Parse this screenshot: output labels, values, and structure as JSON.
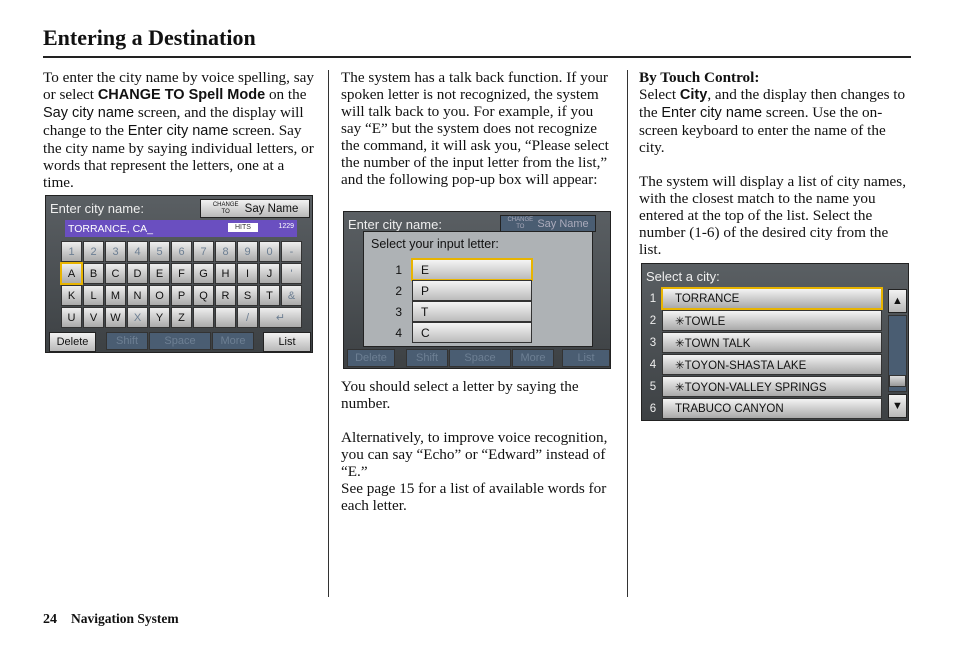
{
  "title": "Entering a Destination",
  "col1": {
    "t1": "To enter the city name by voice spelling, say or select ",
    "t2": "CHANGE TO Spell Mode",
    "t3": " on the ",
    "t4": "Say city name",
    "t5": " screen, and the display will change to the ",
    "t6": "Enter city name",
    "t7": " screen. Say the city name by saying individual letters, or words that represent the letters, one at a time."
  },
  "col2": {
    "p1": "The system has a talk back function. If your spoken letter is not recognized, the system will talk back to you. For example, if you say “E” but the system does not recognize the command, it will ask you, “Please select the number of the input letter from the list,” and the following pop-up box will appear:",
    "p2": "You should select a letter by saying the number.",
    "p3": "Alternatively, to improve voice recognition, you can say “Echo” or “Edward” instead of “E.”",
    "p4": "See page 15 for a list of available words for each letter."
  },
  "col3": {
    "heading": "By Touch Control:",
    "t1": "Select ",
    "t2": "City",
    "t3": ", and the display then changes to the ",
    "t4": "Enter city name",
    "t5": " screen. Use the on-screen keyboard to enter the name of the city.",
    "p2": "The system will display a list of city names, with the closest match to the name you entered at the top of the list. Select the number (1-6) of the desired city from the list."
  },
  "screen1": {
    "title": "Enter city name:",
    "change_small": "CHANGE TO",
    "change_label": "Say Name",
    "input_value": "TORRANCE, CA_",
    "hits_label": "HITS",
    "hits_value": "1229",
    "keys": [
      [
        "1",
        "2",
        "3",
        "4",
        "5",
        "6",
        "7",
        "8",
        "9",
        "0",
        "-"
      ],
      [
        "A",
        "B",
        "C",
        "D",
        "E",
        "F",
        "G",
        "H",
        "I",
        "J",
        "'"
      ],
      [
        "K",
        "L",
        "M",
        "N",
        "O",
        "P",
        "Q",
        "R",
        "S",
        "T",
        "&"
      ],
      [
        "U",
        "V",
        "W",
        "X",
        "Y",
        "Z",
        "",
        "",
        "/",
        "↵"
      ]
    ],
    "disabled_keys": [
      "1",
      "2",
      "3",
      "4",
      "5",
      "6",
      "7",
      "8",
      "9",
      "0",
      "-",
      "'",
      "&",
      "X",
      "",
      "/",
      "↵"
    ],
    "selected_key": "A",
    "delete": "Delete",
    "shift": "Shift",
    "space": "Space",
    "more": "More",
    "list": "List"
  },
  "screen2": {
    "bg_title": "Enter city name:",
    "change_small": "CHANGE TO",
    "change_label": "Say Name",
    "popup_title": "Select your input letter:",
    "options": [
      {
        "n": "1",
        "letter": "E"
      },
      {
        "n": "2",
        "letter": "P"
      },
      {
        "n": "3",
        "letter": "T"
      },
      {
        "n": "4",
        "letter": "C"
      }
    ],
    "selected": "1",
    "delete": "Delete",
    "shift": "Shift",
    "space": "Space",
    "more": "More",
    "list": "List"
  },
  "screen3": {
    "title": "Select a city:",
    "cities": [
      {
        "n": "1",
        "name": "TORRANCE"
      },
      {
        "n": "2",
        "name": "✳TOWLE"
      },
      {
        "n": "3",
        "name": "✳TOWN TALK"
      },
      {
        "n": "4",
        "name": "✳TOYON-SHASTA LAKE"
      },
      {
        "n": "5",
        "name": "✳TOYON-VALLEY SPRINGS"
      },
      {
        "n": "6",
        "name": "TRABUCO CANYON"
      }
    ],
    "selected": "1",
    "up": "▲",
    "down": "▼"
  },
  "footer": {
    "page": "24",
    "section": "Navigation System"
  }
}
